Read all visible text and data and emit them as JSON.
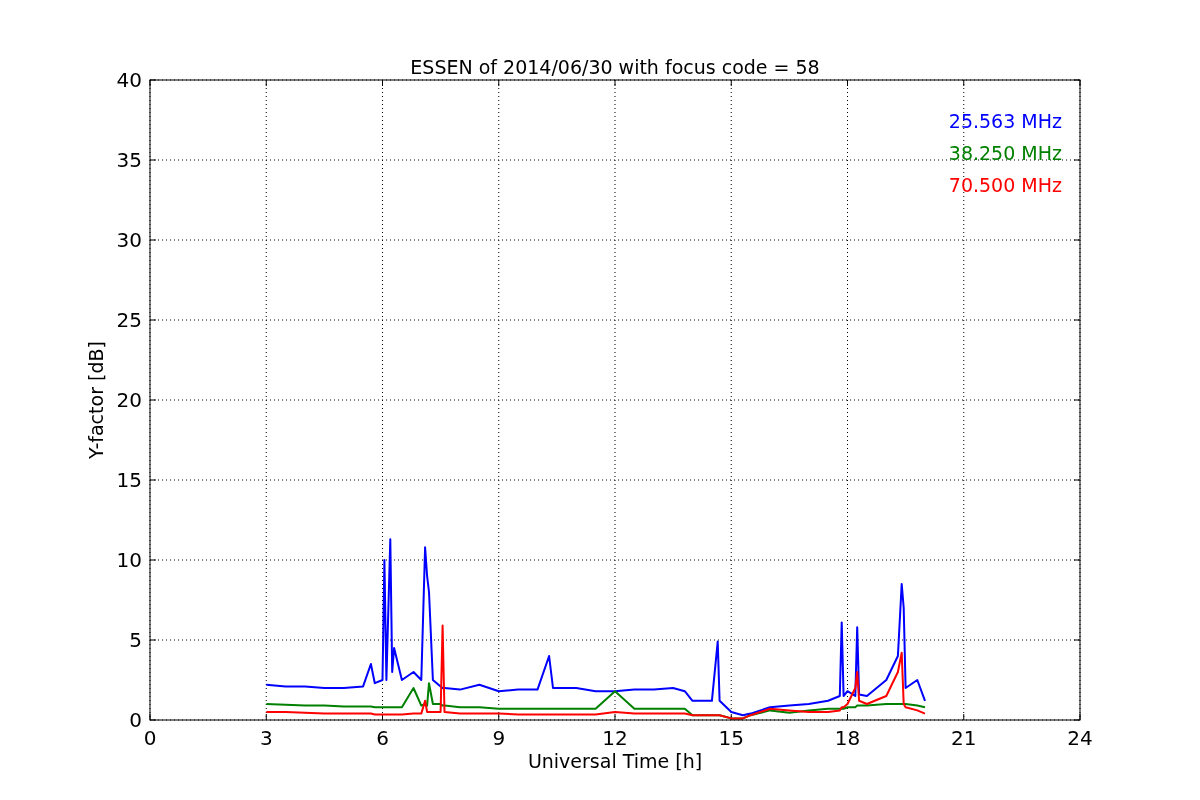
{
  "chart_data": {
    "type": "line",
    "title": "ESSEN of 2014/06/30 with focus code = 58",
    "xlabel": "Universal Time [h]",
    "ylabel": "Y-factor [dB]",
    "x": [
      3,
      3.5,
      4,
      4.5,
      5,
      5.5,
      5.7,
      5.8,
      6,
      6.05,
      6.1,
      6.2,
      6.25,
      6.3,
      6.5,
      6.8,
      7,
      7.1,
      7.15,
      7.2,
      7.3,
      7.5,
      7.55,
      7.6,
      8,
      8.5,
      9,
      9.5,
      10,
      10.3,
      10.4,
      11,
      11.5,
      12,
      12.5,
      13,
      13.5,
      13.8,
      14,
      14.5,
      14.65,
      14.7,
      15,
      15.3,
      15.5,
      16,
      16.5,
      17,
      17.5,
      17.8,
      17.85,
      17.9,
      18,
      18.2,
      18.25,
      18.3,
      18.5,
      19,
      19.3,
      19.4,
      19.45,
      19.5,
      19.8,
      20
    ],
    "series": [
      {
        "name": "25.563 MHz",
        "color": "#0000ff",
        "values": [
          2.2,
          2.1,
          2.1,
          2.0,
          2.0,
          2.1,
          3.5,
          2.3,
          2.5,
          10,
          2.5,
          11.3,
          3,
          4.5,
          2.5,
          3,
          2.5,
          10.8,
          9,
          8,
          2.5,
          2.1,
          2.0,
          2.0,
          1.9,
          2.2,
          1.8,
          1.9,
          1.9,
          4,
          2,
          2.0,
          1.8,
          1.8,
          1.9,
          1.9,
          2.0,
          1.8,
          1.2,
          1.2,
          4.9,
          1.2,
          0.5,
          0.3,
          0.4,
          0.8,
          0.9,
          1.0,
          1.2,
          1.5,
          6.1,
          1.5,
          1.8,
          1.5,
          5.8,
          1.6,
          1.5,
          2.5,
          4,
          8.5,
          7,
          2,
          2.5,
          1.2
        ]
      },
      {
        "name": "38.250 MHz",
        "color": "#008000",
        "values": [
          1.0,
          0.95,
          0.9,
          0.9,
          0.85,
          0.85,
          0.85,
          0.8,
          0.8,
          0.8,
          0.8,
          0.8,
          0.8,
          0.8,
          0.8,
          2.0,
          0.9,
          1.0,
          0.9,
          2.3,
          1.0,
          1.0,
          0.9,
          0.9,
          0.8,
          0.8,
          0.7,
          0.7,
          0.7,
          0.7,
          0.7,
          0.7,
          0.7,
          1.8,
          0.7,
          0.7,
          0.7,
          0.7,
          0.3,
          0.3,
          0.3,
          0.3,
          0.1,
          0.1,
          0.3,
          0.6,
          0.45,
          0.6,
          0.7,
          0.7,
          0.7,
          0.7,
          0.8,
          0.8,
          0.9,
          0.9,
          0.9,
          1.0,
          1.0,
          1.0,
          1.0,
          1.0,
          0.9,
          0.8
        ]
      },
      {
        "name": "70.500 MHz",
        "color": "#ff0000",
        "values": [
          0.5,
          0.5,
          0.45,
          0.4,
          0.4,
          0.4,
          0.4,
          0.35,
          0.35,
          0.35,
          0.35,
          0.35,
          0.35,
          0.35,
          0.35,
          0.4,
          0.4,
          1.2,
          0.5,
          0.5,
          0.5,
          0.5,
          5.9,
          0.5,
          0.4,
          0.4,
          0.4,
          0.35,
          0.35,
          0.35,
          0.35,
          0.35,
          0.35,
          0.5,
          0.4,
          0.4,
          0.4,
          0.4,
          0.3,
          0.3,
          0.3,
          0.3,
          0.1,
          0.1,
          0.3,
          0.7,
          0.6,
          0.5,
          0.5,
          0.6,
          0.8,
          0.8,
          1.0,
          2.0,
          3.0,
          1.2,
          1.0,
          1.5,
          3.0,
          4.2,
          1.0,
          0.8,
          0.6,
          0.4
        ]
      }
    ],
    "grid": true,
    "xlim": [
      0,
      24
    ],
    "ylim": [
      0,
      40
    ],
    "xticks": [
      0,
      3,
      6,
      9,
      12,
      15,
      18,
      21,
      24
    ],
    "yticks": [
      0,
      5,
      10,
      15,
      20,
      25,
      30,
      35,
      40
    ]
  }
}
